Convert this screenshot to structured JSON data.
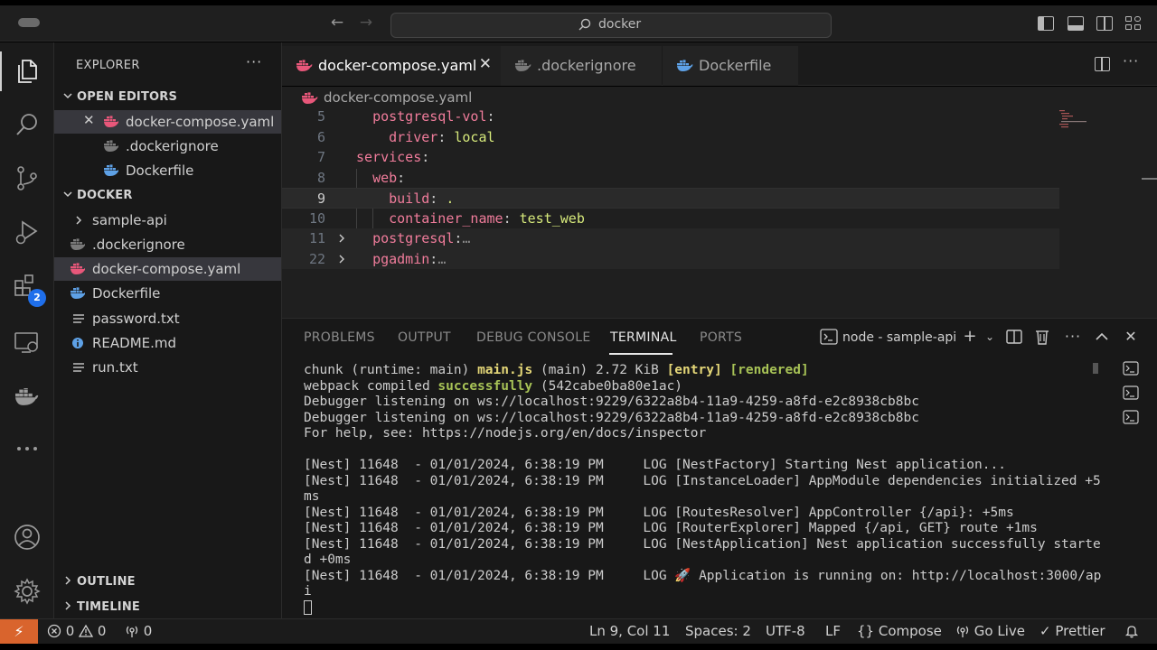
{
  "titlebar": {
    "search_text": "docker"
  },
  "activity_bar": {
    "extensions_badge": "2"
  },
  "sidebar": {
    "title": "EXPLORER",
    "open_editors": {
      "header": "OPEN EDITORS",
      "items": [
        {
          "name": "docker-compose.yaml",
          "icon": "docker-icon-pink",
          "selected": true
        },
        {
          "name": ".dockerignore",
          "icon": "docker-icon-gray"
        },
        {
          "name": "Dockerfile",
          "icon": "docker-icon-blue"
        }
      ]
    },
    "folder": {
      "header": "DOCKER",
      "items": [
        {
          "name": "sample-api",
          "type": "folder"
        },
        {
          "name": ".dockerignore",
          "icon": "docker-icon-gray"
        },
        {
          "name": "docker-compose.yaml",
          "icon": "docker-icon-pink",
          "selected": true
        },
        {
          "name": "Dockerfile",
          "icon": "docker-icon-blue"
        },
        {
          "name": "password.txt",
          "icon": "lines-icon"
        },
        {
          "name": "README.md",
          "icon": "info-icon"
        },
        {
          "name": "run.txt",
          "icon": "lines-icon"
        }
      ]
    },
    "outline": "OUTLINE",
    "timeline": "TIMELINE"
  },
  "editor": {
    "tabs": [
      {
        "label": "docker-compose.yaml",
        "active": true,
        "icon": "docker-icon-pink"
      },
      {
        "label": ".dockerignore",
        "active": false,
        "icon": "docker-icon-gray"
      },
      {
        "label": "Dockerfile",
        "active": false,
        "icon": "docker-icon-blue"
      }
    ],
    "breadcrumb": "docker-compose.yaml",
    "lines": [
      {
        "num": "5",
        "indent": "  ",
        "key": "postgresql-vol",
        "sep": ":",
        "value": ""
      },
      {
        "num": "6",
        "indent": "    ",
        "key": "driver",
        "sep": ": ",
        "value": "local"
      },
      {
        "num": "7",
        "indent": "",
        "key": "services",
        "sep": ":",
        "value": ""
      },
      {
        "num": "8",
        "indent": "  ",
        "key": "web",
        "sep": ":",
        "value": ""
      },
      {
        "num": "9",
        "indent": "    ",
        "key": "build",
        "sep": ": ",
        "value": "."
      },
      {
        "num": "10",
        "indent": "    ",
        "key": "container_name",
        "sep": ": ",
        "value": "test_web"
      },
      {
        "num": "11",
        "indent": "  ",
        "key": "postgresql",
        "sep": ":",
        "value": "",
        "folded": "…"
      },
      {
        "num": "22",
        "indent": "  ",
        "key": "pgadmin",
        "sep": ":",
        "value": "",
        "folded": "…"
      }
    ]
  },
  "panel": {
    "tabs": [
      "PROBLEMS",
      "OUTPUT",
      "DEBUG CONSOLE",
      "TERMINAL",
      "PORTS"
    ],
    "active_tab": "TERMINAL",
    "terminal_name": "node - sample-api",
    "output": {
      "chunk_a": "chunk (runtime: main) ",
      "chunk_file": "main.js",
      "chunk_b": " (main) 2.72 KiB ",
      "chunk_entry": "[entry]",
      "chunk_rendered": "[rendered]",
      "compiled_a": "webpack compiled ",
      "compiled_ok": "successfully",
      "compiled_b": " (542cabe0ba80e1ac)",
      "debugger_1": "Debugger listening on ws://localhost:9229/6322a8b4-11a9-4259-a8fd-e2c8938cb8bc",
      "debugger_2": "Debugger listening on ws://localhost:9229/6322a8b4-11a9-4259-a8fd-e2c8938cb8bc",
      "help": "For help, see: https://nodejs.org/en/docs/inspector",
      "nest_lines": [
        "[Nest] 11648  - 01/01/2024, 6:38:19 PM     LOG [NestFactory] Starting Nest application...",
        "[Nest] 11648  - 01/01/2024, 6:38:19 PM     LOG [InstanceLoader] AppModule dependencies initialized +5",
        "ms",
        "[Nest] 11648  - 01/01/2024, 6:38:19 PM     LOG [RoutesResolver] AppController {/api}: +5ms",
        "[Nest] 11648  - 01/01/2024, 6:38:19 PM     LOG [RouterExplorer] Mapped {/api, GET} route +1ms",
        "[Nest] 11648  - 01/01/2024, 6:38:19 PM     LOG [NestApplication] Nest application successfully starte",
        "d +0ms",
        "[Nest] 11648  - 01/01/2024, 6:38:19 PM     LOG 🚀 Application is running on: http://localhost:3000/ap",
        "i"
      ]
    }
  },
  "statusbar": {
    "errors": "0",
    "warnings": "0",
    "ports": "0",
    "position": "Ln 9, Col 11",
    "spaces": "Spaces: 2",
    "encoding": "UTF-8",
    "eol": "LF",
    "compose": "Compose",
    "golive": "Go Live",
    "prettier": "Prettier"
  },
  "colors": {
    "accent_remote": "#d9642d",
    "yaml_key": "#f07c9b",
    "yaml_value": "#d6e97b",
    "docker_pink": "#e8577a",
    "docker_blue": "#5ea1e6",
    "terminal_green": "#a7c256",
    "terminal_red": "#f04f76"
  }
}
